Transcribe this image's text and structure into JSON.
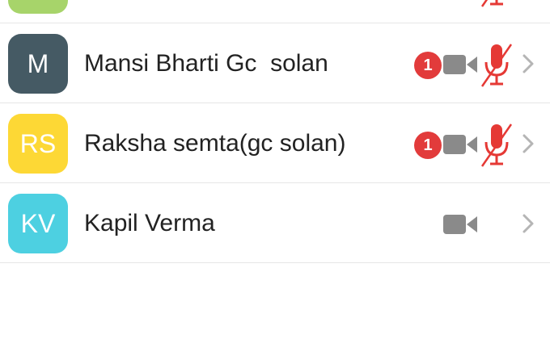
{
  "contacts": [
    {
      "initials": "",
      "name": "",
      "avatar_color": "#a7d46a",
      "unread": "",
      "has_video": false,
      "mic_muted": true
    },
    {
      "initials": "M",
      "name": "Mansi Bharti Gc  solan",
      "avatar_color": "#455a64",
      "unread": "1",
      "has_video": true,
      "mic_muted": true
    },
    {
      "initials": "RS",
      "name": "Raksha semta(gc solan)",
      "avatar_color": "#fdd835",
      "unread": "1",
      "has_video": true,
      "mic_muted": true
    },
    {
      "initials": "KV",
      "name": "Kapil Verma",
      "avatar_color": "#4dd0e1",
      "unread": "",
      "has_video": true,
      "mic_muted": false
    }
  ],
  "colors": {
    "icon_gray": "#8a8a8a",
    "muted_red": "#e53935",
    "badge_red": "#e23b3b",
    "chevron_gray": "#b5b5b5",
    "divider": "#e6e6e6"
  },
  "icons": {
    "video": "video-camera-icon",
    "mic_muted": "mic-off-icon",
    "chevron": "chevron-right-icon"
  }
}
